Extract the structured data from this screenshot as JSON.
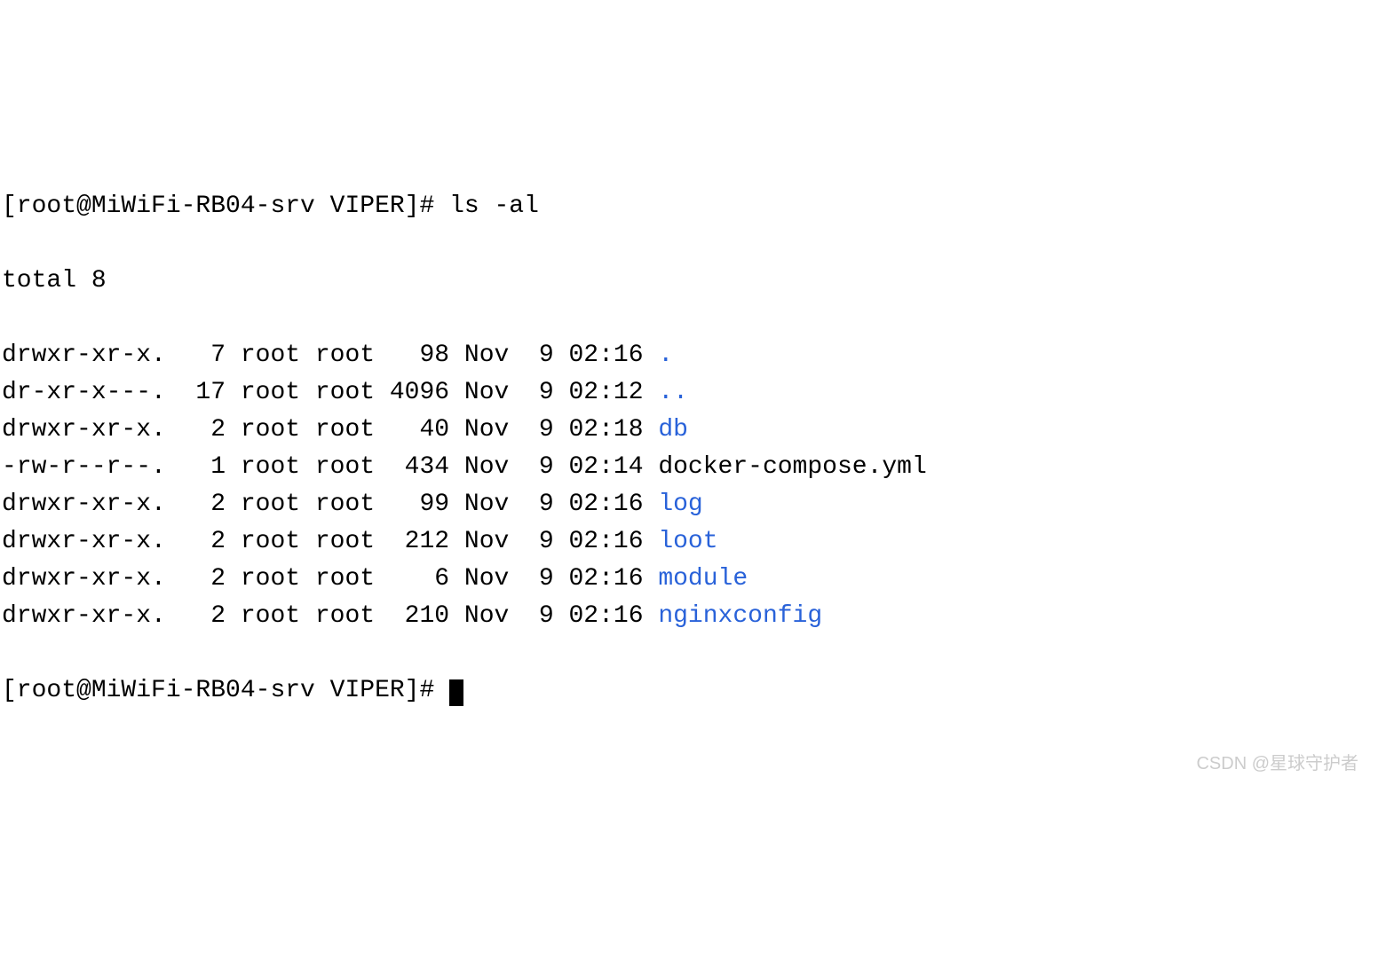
{
  "prompt1": "[root@MiWiFi-RB04-srv VIPER]# ",
  "command1": "ls -al",
  "total_line": "total 8",
  "rows": [
    {
      "perm": "drwxr-xr-x.",
      "links": "  7",
      "owner": "root",
      "group": "root",
      "size": "  98",
      "month": "Nov",
      "day": " 9",
      "time": "02:16",
      "name": ".",
      "type": "dir"
    },
    {
      "perm": "dr-xr-x---.",
      "links": " 17",
      "owner": "root",
      "group": "root",
      "size": "4096",
      "month": "Nov",
      "day": " 9",
      "time": "02:12",
      "name": "..",
      "type": "dir"
    },
    {
      "perm": "drwxr-xr-x.",
      "links": "  2",
      "owner": "root",
      "group": "root",
      "size": "  40",
      "month": "Nov",
      "day": " 9",
      "time": "02:18",
      "name": "db",
      "type": "dir"
    },
    {
      "perm": "-rw-r--r--.",
      "links": "  1",
      "owner": "root",
      "group": "root",
      "size": " 434",
      "month": "Nov",
      "day": " 9",
      "time": "02:14",
      "name": "docker-compose.yml",
      "type": "file"
    },
    {
      "perm": "drwxr-xr-x.",
      "links": "  2",
      "owner": "root",
      "group": "root",
      "size": "  99",
      "month": "Nov",
      "day": " 9",
      "time": "02:16",
      "name": "log",
      "type": "dir"
    },
    {
      "perm": "drwxr-xr-x.",
      "links": "  2",
      "owner": "root",
      "group": "root",
      "size": " 212",
      "month": "Nov",
      "day": " 9",
      "time": "02:16",
      "name": "loot",
      "type": "dir"
    },
    {
      "perm": "drwxr-xr-x.",
      "links": "  2",
      "owner": "root",
      "group": "root",
      "size": "   6",
      "month": "Nov",
      "day": " 9",
      "time": "02:16",
      "name": "module",
      "type": "dir"
    },
    {
      "perm": "drwxr-xr-x.",
      "links": "  2",
      "owner": "root",
      "group": "root",
      "size": " 210",
      "month": "Nov",
      "day": " 9",
      "time": "02:16",
      "name": "nginxconfig",
      "type": "dir"
    }
  ],
  "prompt2": "[root@MiWiFi-RB04-srv VIPER]# ",
  "watermark": "CSDN @星球守护者"
}
